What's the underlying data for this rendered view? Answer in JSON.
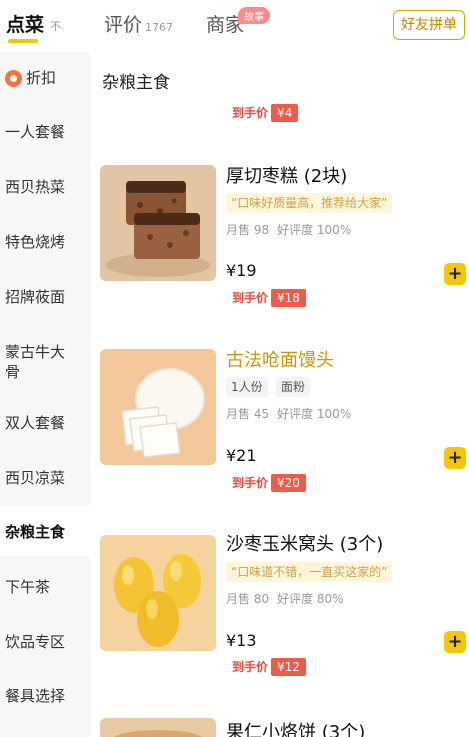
{
  "tabs": {
    "order": "点菜",
    "order_mark": "不",
    "reviews": "评价",
    "reviews_count": "1767",
    "merchant": "商家",
    "story_badge": "故事",
    "share_button": "好友拼单"
  },
  "sidebar": {
    "items": [
      {
        "label": "折扣"
      },
      {
        "label": "一人套餐"
      },
      {
        "label": "西贝热菜"
      },
      {
        "label": "特色烧烤"
      },
      {
        "label": "招牌莜面"
      },
      {
        "label": "蒙古牛大骨"
      },
      {
        "label": "双人套餐"
      },
      {
        "label": "西贝凉菜"
      },
      {
        "label": "杂粮主食"
      },
      {
        "label": "下午茶"
      },
      {
        "label": "饮品专区"
      },
      {
        "label": "餐具选择"
      }
    ],
    "active_index": 8
  },
  "main": {
    "section_title": "杂粮主食",
    "top_price_tag": {
      "label": "到手价",
      "value": "¥4"
    },
    "products": [
      {
        "name": "厚切枣糕 (2块)",
        "slogan": "“口味好质量高，推荐给大家”",
        "sales": "月售 98",
        "rating": "好评度 100%",
        "price": "¥19",
        "final_label": "到手价",
        "final_price": "¥18",
        "image": "date-cake-image"
      },
      {
        "name": "古法呛面馒头",
        "tags": [
          "1人份",
          "面粉"
        ],
        "sales": "月售 45",
        "rating": "好评度 100%",
        "price": "¥21",
        "final_label": "到手价",
        "final_price": "¥20",
        "image": "steamed-bun-image"
      },
      {
        "name": "沙枣玉米窝头 (3个)",
        "slogan": "“口味道不错，一直买这家的”",
        "sales": "月售 80",
        "rating": "好评度 80%",
        "price": "¥13",
        "final_label": "到手价",
        "final_price": "¥12",
        "image": "corn-bun-image"
      },
      {
        "name": "果仁小烙饼 (3个)",
        "image": "nut-pancake-image"
      }
    ],
    "add_label": "+"
  },
  "colors": {
    "accent_yellow": "#f7c600",
    "price_red": "#f05a4a",
    "sidebar_bg": "#f7f7f7"
  }
}
